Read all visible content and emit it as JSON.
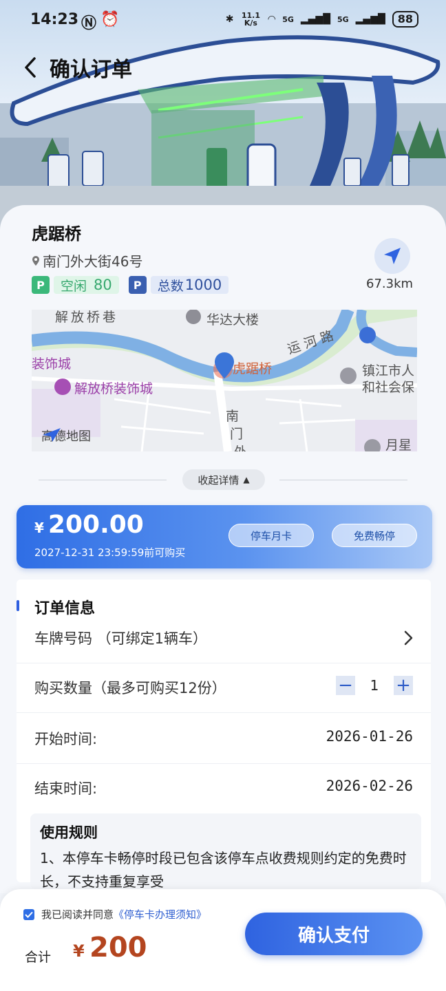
{
  "status_bar": {
    "time": "14:23",
    "net_speed": "11.1 K/s",
    "battery": "88",
    "signal1": "5G",
    "signal2": "5G"
  },
  "header": {
    "title": "确认订单"
  },
  "station": {
    "name": "虎踞桥",
    "address": "南门外大街46号",
    "free_label": "空闲",
    "free_count": "80",
    "total_label": "总数",
    "total_count": "1000",
    "distance": "67.3km"
  },
  "map": {
    "labels": [
      "解放桥巷",
      "华达大楼",
      "运河路",
      "装饰城",
      "虎踞桥",
      "镇江市人",
      "和社会保",
      "解放桥装饰城",
      "南",
      "门",
      "外",
      "月星"
    ],
    "provider": "高德地图"
  },
  "collapse": {
    "label": "收起详情"
  },
  "price_card": {
    "currency": "¥",
    "amount": "200.00",
    "deadline": "2027-12-31 23:59:59前可购买",
    "btn_monthly": "停车月卡",
    "btn_free": "免费畅停"
  },
  "order": {
    "section_title": "订单信息",
    "plate_label": "车牌号码 （可绑定1辆车）",
    "qty_label": "购买数量（最多可购买12份）",
    "qty_value": "1",
    "start_label": "开始时间:",
    "start_value": "2026-01-26",
    "end_label": "结束时间:",
    "end_value": "2026-02-26"
  },
  "rules": {
    "title": "使用规则",
    "body": "1、本停车卡畅停时段已包含该停车点收费规则约定的免费时长，不支持重复享受"
  },
  "bottom": {
    "agree_text": "我已阅读并同意",
    "agree_link": "《停车卡办理须知》",
    "total_label": "合计",
    "total_currency": "¥",
    "total_amount": "200",
    "pay_button": "确认支付"
  },
  "colors": {
    "accent": "#2f6ee5",
    "price": "#b4451f",
    "free_green": "#3bb87a",
    "total_blue": "#3a5fb0"
  }
}
